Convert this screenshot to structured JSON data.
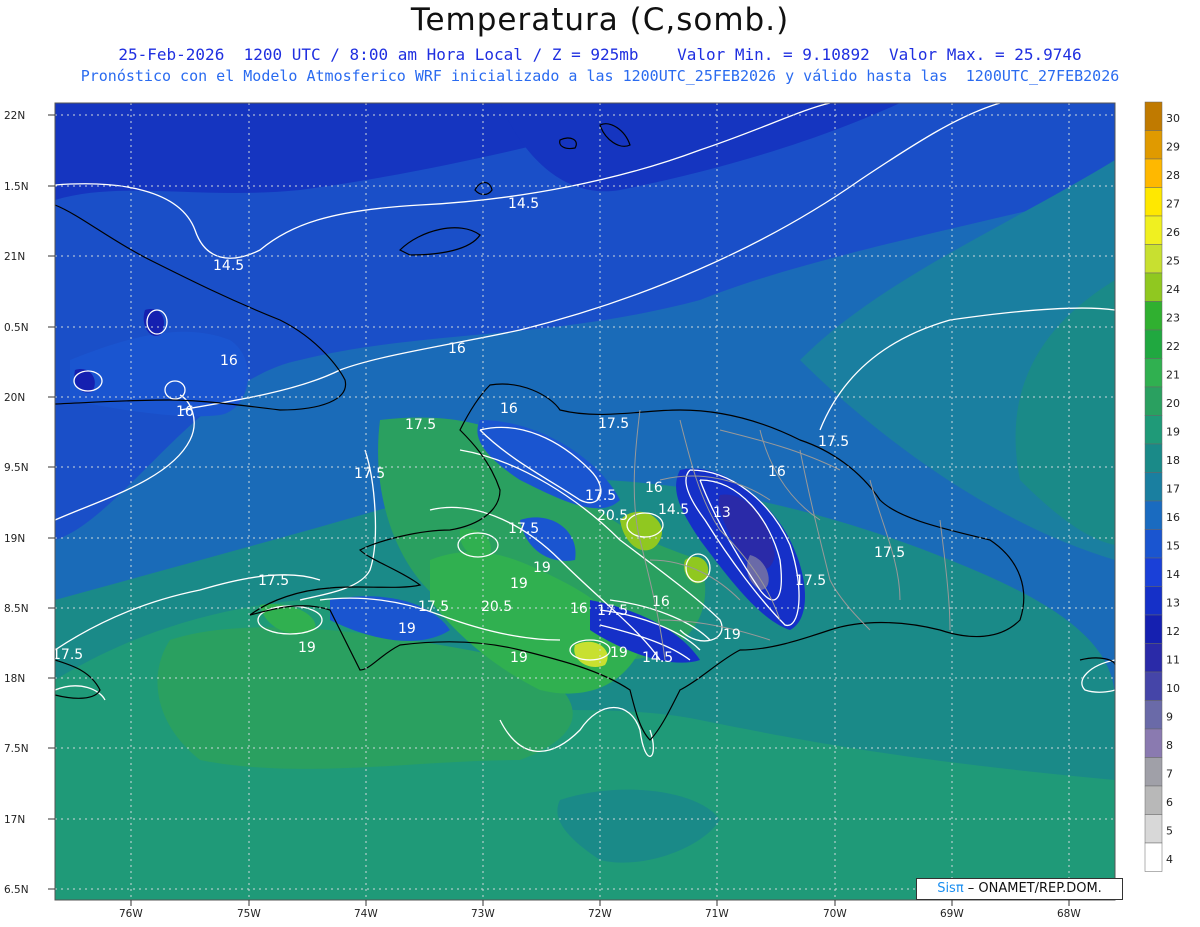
{
  "header": {
    "title": "Temperatura (C,somb.)",
    "subtitle_line1": "25-Feb-2026  1200 UTC / 8:00 am Hora Local / Z = 925mb    Valor Min. = 9.10892  Valor Max. = 25.9746",
    "subtitle_line2": "Pronóstico con el Modelo Atmosferico WRF inicializado a las 1200UTC_25FEB2026 y válido hasta las  1200UTC_27FEB2026"
  },
  "map": {
    "lat_ticks": [
      "22N",
      "1.5N",
      "21N",
      "0.5N",
      "20N",
      "9.5N",
      "19N",
      "8.5N",
      "18N",
      "7.5N",
      "17N",
      "6.5N"
    ],
    "lon_ticks": [
      "76W",
      "75W",
      "74W",
      "73W",
      "72W",
      "71W",
      "70W",
      "69W",
      "68W"
    ],
    "contour_labels": [
      {
        "text": "14.5",
        "id": "c1"
      },
      {
        "text": "14.5",
        "id": "c2"
      },
      {
        "text": "16",
        "id": "c3"
      },
      {
        "text": "16",
        "id": "c4"
      },
      {
        "text": "16",
        "id": "c5"
      },
      {
        "text": "16",
        "id": "c6"
      },
      {
        "text": "17.5",
        "id": "c7"
      },
      {
        "text": "17.5",
        "id": "c8"
      },
      {
        "text": "17.5",
        "id": "c9"
      },
      {
        "text": "17.5",
        "id": "c10"
      },
      {
        "text": "17.5",
        "id": "c11"
      },
      {
        "text": "17.5",
        "id": "c12"
      },
      {
        "text": "17.5",
        "id": "c13"
      },
      {
        "text": "17.5",
        "id": "c14"
      },
      {
        "text": "17.5",
        "id": "c15"
      },
      {
        "text": "19",
        "id": "c16"
      },
      {
        "text": "19",
        "id": "c17"
      },
      {
        "text": "19",
        "id": "c18"
      },
      {
        "text": "19",
        "id": "c19"
      },
      {
        "text": "19",
        "id": "c20"
      },
      {
        "text": "20.5",
        "id": "c21"
      },
      {
        "text": "20.5",
        "id": "c22"
      },
      {
        "text": "16",
        "id": "c23"
      },
      {
        "text": "13",
        "id": "c24"
      },
      {
        "text": "14.5",
        "id": "c25"
      },
      {
        "text": "16",
        "id": "c26"
      },
      {
        "text": "19",
        "id": "c27"
      },
      {
        "text": "14.5",
        "id": "c28"
      },
      {
        "text": "17.5",
        "id": "c29"
      },
      {
        "text": "19",
        "id": "c30"
      },
      {
        "text": "17.5",
        "id": "c31"
      }
    ]
  },
  "colorbar": {
    "levels": [
      "30",
      "29",
      "28",
      "27",
      "26",
      "25",
      "24",
      "23",
      "22",
      "21",
      "20",
      "19",
      "18",
      "17",
      "16",
      "15",
      "14",
      "13",
      "12",
      "11",
      "10",
      "9",
      "8",
      "7",
      "6",
      "5",
      "4"
    ],
    "colors": [
      "#c07a00",
      "#e09a00",
      "#ffb800",
      "#ffe800",
      "#f0f020",
      "#c8e030",
      "#90c820",
      "#30b030",
      "#20a840",
      "#30b050",
      "#2aa060",
      "#1f9a78",
      "#1a8a88",
      "#1a7fa0",
      "#1a6bc0",
      "#1a55d0",
      "#1a40d8",
      "#1530c8",
      "#1520b0",
      "#2a2aa8",
      "#4545a8",
      "#6a6aa8",
      "#8a7ab0",
      "#a0a0a8",
      "#b8b8b8",
      "#d8d8d8",
      "#ffffff"
    ]
  },
  "credit": {
    "sis": "Sisπ",
    "rest": " – ONAMET/REP.DOM."
  }
}
